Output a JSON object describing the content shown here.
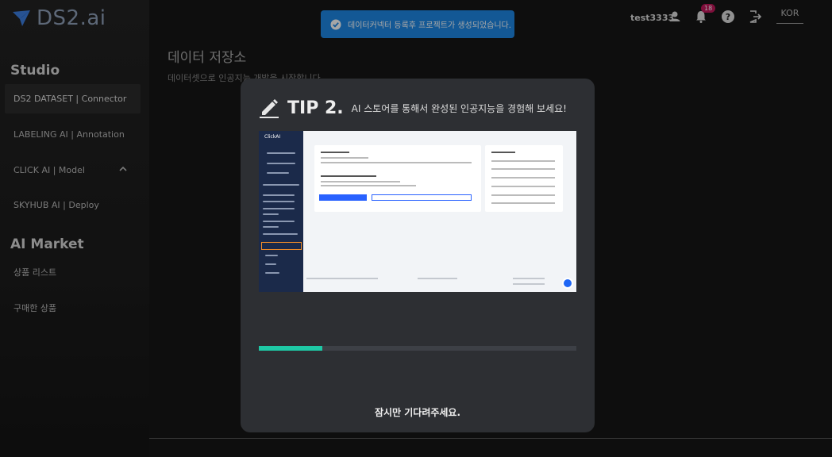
{
  "app": {
    "logo_text": "DS2.ai"
  },
  "sidebar": {
    "studio_title": "Studio",
    "items": [
      {
        "label": "DS2 DATASET | Connector",
        "active": true
      },
      {
        "label": "LABELING AI | Annotation",
        "active": false
      },
      {
        "label": "CLICK AI | Model",
        "active": false,
        "expanded": true
      },
      {
        "label": "SKYHUB AI | Deploy",
        "active": false
      }
    ],
    "market_title": "AI Market",
    "market_items": [
      {
        "label": "상품 리스트"
      },
      {
        "label": "구매한 상품"
      }
    ]
  },
  "main": {
    "title": "데이터 저장소",
    "subtitle": "데이터셋으로 인공지능 개발을 시작합니다"
  },
  "header": {
    "username": "test3333",
    "notification_count": "18",
    "language": "KOR",
    "icons": [
      "user-icon",
      "bell-icon",
      "help-icon",
      "logout-icon"
    ]
  },
  "toast": {
    "message": "데이터커넥터 등록후 프로젝트가 생성되었습니다.",
    "color": "#1e88e5"
  },
  "modal": {
    "tip_title": "TIP 2.",
    "tip_description": "AI 스토어를 통해서 완성된 인공지능을 경험해 보세요!",
    "preview_logo": "ClickAI",
    "progress": 0.2,
    "progress_color": "#1ec8a5",
    "wait_text": "잠시만 기다려주세요."
  }
}
